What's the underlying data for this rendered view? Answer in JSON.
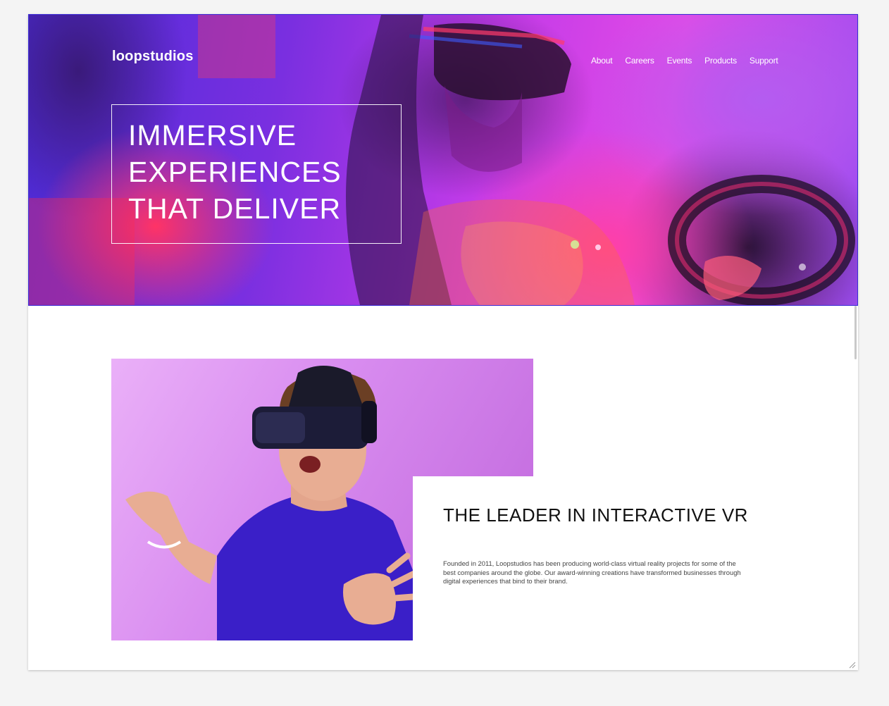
{
  "header": {
    "logo": "loopstudios",
    "nav": [
      {
        "label": "About"
      },
      {
        "label": "Careers"
      },
      {
        "label": "Events"
      },
      {
        "label": "Products"
      },
      {
        "label": "Support"
      }
    ]
  },
  "hero": {
    "lines": [
      "IMMERSIVE",
      "EXPERIENCES",
      "THAT DELIVER"
    ]
  },
  "about": {
    "title": "THE LEADER IN INTERACTIVE VR",
    "text": "Founded in 2011, Loopstudios has been producing world-class virtual reality projects for some of the best companies around the globe. Our award-winning creations have transformed businesses through digital experiences that bind to their brand."
  },
  "colors": {
    "hero_border": "#3b2bd6",
    "text_dark": "#111111",
    "body_text": "#444444",
    "shirt_blue": "#3a1fc8",
    "image_bg": "#d98df0"
  }
}
